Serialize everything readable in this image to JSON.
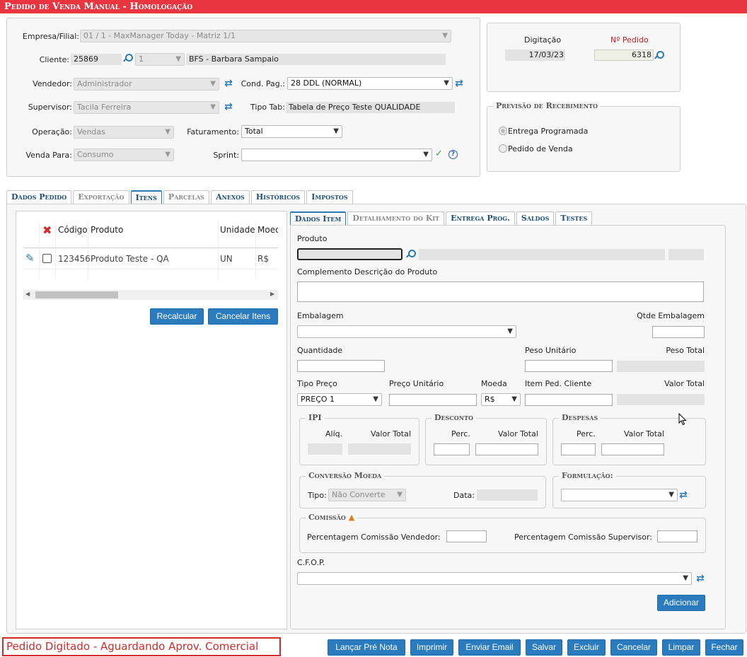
{
  "window": {
    "title": "Pedido de Venda Manual  - Homologação"
  },
  "header": {
    "empresa_label": "Empresa/Filial:",
    "empresa_value": "01 / 1 - MaxManager Today - Matriz 1/1",
    "cliente_label": "Cliente:",
    "cliente_code": "25869",
    "cliente_seq": "1",
    "cliente_name": "BFS - Barbara Sampaio",
    "vendedor_label": "Vendedor:",
    "vendedor_value": "Administrador",
    "condpag_label": "Cond. Pag.:",
    "condpag_value": "28 DDL (NORMAL)",
    "supervisor_label": "Supervisor:",
    "supervisor_value": "Tacila Ferreira",
    "tipotab_label": "Tipo Tab:",
    "tipotab_value": "Tabela de Preço Teste QUALIDADE",
    "operacao_label": "Operação:",
    "operacao_value": "Vendas",
    "faturamento_label": "Faturamento:",
    "faturamento_value": "Total",
    "vendapara_label": "Venda Para:",
    "vendapara_value": "Consumo",
    "sprint_label": "Sprint:",
    "sprint_value": ""
  },
  "order_info": {
    "digitacao_label": "Digitação",
    "digitacao_value": "17/03/23",
    "npedido_label": "Nº Pedido",
    "npedido_value": "6318",
    "npedido_color": "#d11a1a"
  },
  "receipt": {
    "title": "Previsão de Recebimento",
    "options": [
      "Entrega Programada",
      "Pedido de Venda"
    ],
    "selected": 0
  },
  "main_tabs": [
    "Dados Pedido",
    "Exportação",
    "Itens",
    "Parcelas",
    "Anexos",
    "Históricos",
    "Impostos"
  ],
  "main_tab_active": 2,
  "items_table": {
    "headers": [
      "Código",
      "Produto",
      "Unidade",
      "Moed"
    ],
    "rows": [
      {
        "codigo": "123456",
        "produto": "Produto Teste - QA",
        "unidade": "UN",
        "moeda": "R$"
      }
    ]
  },
  "items_buttons": {
    "recalcular": "Recalcular",
    "cancelar": "Cancelar Itens"
  },
  "item_tabs": [
    "Dados Item",
    "Detalhamento do Kit",
    "Entrega Prog.",
    "Saldos",
    "Testes"
  ],
  "item": {
    "produto_label": "Produto",
    "complemento_label": "Complemento Descrição do Produto",
    "embalagem_label": "Embalagem",
    "qtde_embalagem_label": "Qtde Embalagem",
    "quantidade_label": "Quantidade",
    "peso_unitario_label": "Peso Unitário",
    "peso_total_label": "Peso Total",
    "tipo_preco_label": "Tipo Preço",
    "tipo_preco_value": "PREÇO 1",
    "preco_unitario_label": "Preço Unitário",
    "moeda_label": "Moeda",
    "moeda_value": "R$",
    "item_ped_cliente_label": "Item Ped. Cliente",
    "valor_total_label": "Valor Total",
    "ipi": {
      "title": "IPI",
      "aliq": "Alíq.",
      "valor_total": "Valor Total"
    },
    "desconto": {
      "title": "Desconto",
      "perc": "Perc.",
      "valor_total": "Valor Total"
    },
    "despesas": {
      "title": "Despesas",
      "perc": "Perc.",
      "valor_total": "Valor Total"
    },
    "conversao": {
      "title": "Conversão Moeda",
      "tipo_label": "Tipo:",
      "tipo_value": "Não Converte",
      "data_label": "Data:"
    },
    "formulacao": {
      "title": "Formulação:"
    },
    "comissao": {
      "title": "Comissão",
      "vendedor_label": "Percentagem Comissão Vendedor:",
      "supervisor_label": "Percentagem Comissão Supervisor:"
    },
    "cfop_label": "C.F.O.P.",
    "adicionar": "Adicionar"
  },
  "status_text": "Pedido Digitado - Aguardando Aprov. Comercial",
  "footer_buttons": [
    "Lançar Pré Nota",
    "Imprimir",
    "Enviar Email",
    "Salvar",
    "Excluir",
    "Cancelar",
    "Limpar",
    "Fechar"
  ]
}
